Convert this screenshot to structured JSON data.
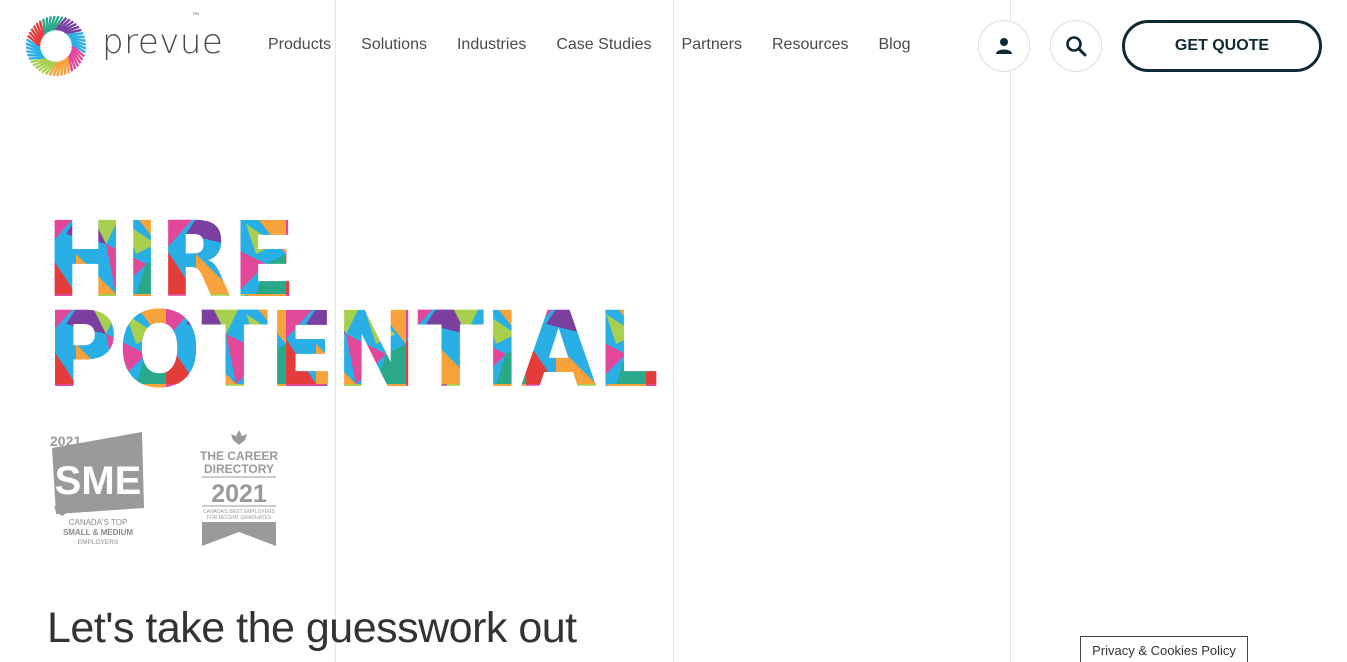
{
  "brand": {
    "name": "prevue",
    "tm": "™"
  },
  "nav": [
    {
      "label": "Products"
    },
    {
      "label": "Solutions"
    },
    {
      "label": "Industries"
    },
    {
      "label": "Case Studies"
    },
    {
      "label": "Partners"
    },
    {
      "label": "Resources"
    },
    {
      "label": "Blog"
    }
  ],
  "header": {
    "account_icon": "user-icon",
    "search_icon": "search-icon",
    "cta_label": "GET QUOTE"
  },
  "hero": {
    "line1": "HIRE",
    "line2": "POTENTIAL",
    "tagline": "Let's take the guesswork out"
  },
  "awards": {
    "sme": {
      "year": "2021",
      "abbr": "SME",
      "caption_1": "CANADA'S TOP",
      "caption_2": "SMALL & MEDIUM",
      "caption_3": "EMPLOYERS"
    },
    "career": {
      "line_1": "THE CAREER",
      "line_2": "DIRECTORY",
      "year": "2021",
      "caption_1": "CANADA'S BEST EMPLOYERS",
      "caption_2": "FOR RECENT GRADUATES"
    }
  },
  "footer": {
    "privacy_label": "Privacy & Cookies Policy"
  },
  "colors": {
    "navy": "#0f2a35",
    "pink": "#e2479a",
    "blue": "#29aee6",
    "green": "#a9cf4f",
    "orange": "#f7a23a",
    "red": "#e43b3b",
    "teal": "#2aa88a",
    "purple": "#7b3fa0",
    "award_gray": "#9a9a9a"
  }
}
